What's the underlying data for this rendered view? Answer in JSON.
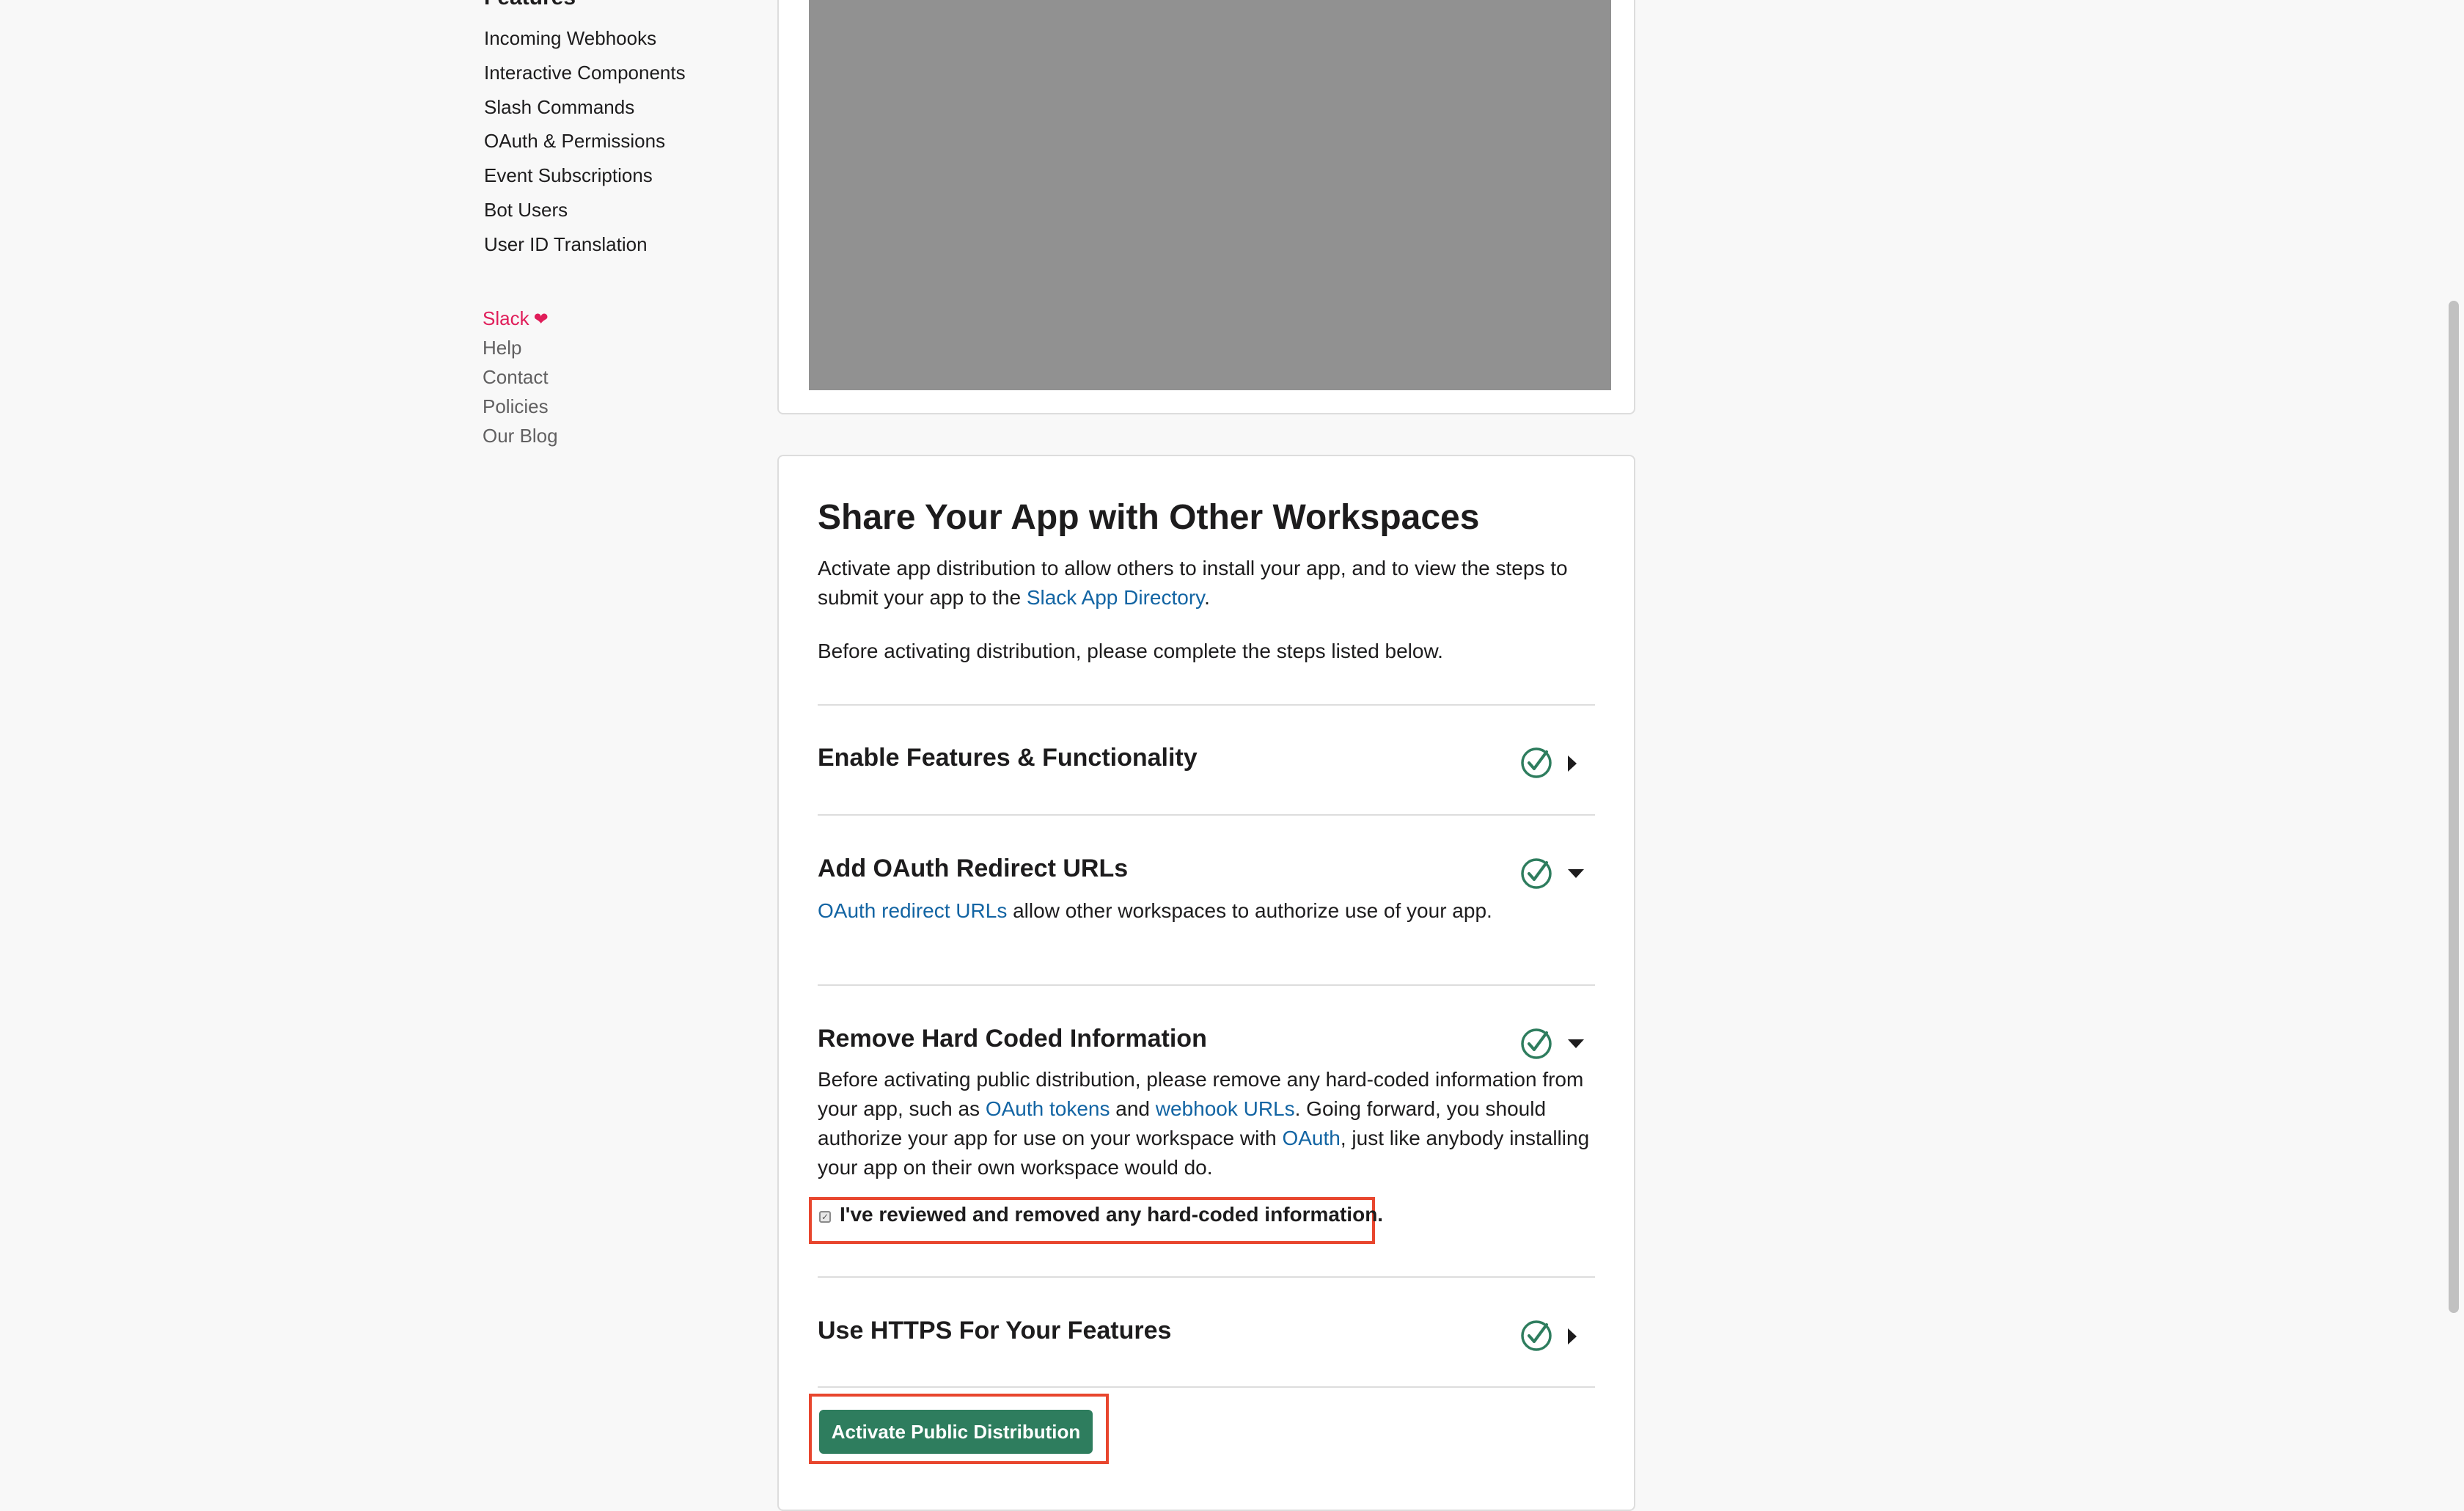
{
  "sidebar": {
    "features_heading": "Features",
    "features": [
      "Incoming Webhooks",
      "Interactive Components",
      "Slash Commands",
      "OAuth & Permissions",
      "Event Subscriptions",
      "Bot Users",
      "User ID Translation"
    ],
    "footer_links": [
      "Slack",
      "Help",
      "Contact",
      "Policies",
      "Our Blog"
    ],
    "heart_icon": "heart-icon"
  },
  "share": {
    "title": "Share Your App with Other Workspaces",
    "intro_text": "Activate app distribution to allow others to install your app, and to view the steps to submit your app to the ",
    "intro_link": "Slack App Directory",
    "intro_end": ".",
    "before_text": "Before activating distribution, please complete the steps listed below.",
    "steps": [
      {
        "title": "Enable Features & Functionality",
        "status": "complete",
        "expanded": false
      },
      {
        "title": "Add OAuth Redirect URLs",
        "status": "complete",
        "expanded": true,
        "link": "OAuth redirect URLs",
        "desc": " allow other workspaces to authorize use of your app."
      },
      {
        "title": "Remove Hard Coded Information",
        "status": "complete",
        "expanded": true,
        "desc1": "Before activating public distribution, please remove any hard-coded information from your app, such as ",
        "link1": "OAuth tokens",
        "desc2": " and ",
        "link2": "webhook URLs",
        "desc3": ". Going forward, you should authorize your app for use on your workspace with ",
        "link3": "OAuth",
        "desc4": ", just like anybody installing your app on their own workspace would do.",
        "checkbox_label": "I've reviewed and removed any hard-coded information.",
        "checkbox_checked": true
      },
      {
        "title": "Use HTTPS For Your Features",
        "status": "complete",
        "expanded": false
      }
    ],
    "activate_button": "Activate Public Distribution"
  },
  "colors": {
    "link": "#1264a3",
    "button": "#2e7d5e",
    "check": "#2e7d5e",
    "highlight": "#e8462e",
    "brand_pink": "#e01e5a"
  }
}
